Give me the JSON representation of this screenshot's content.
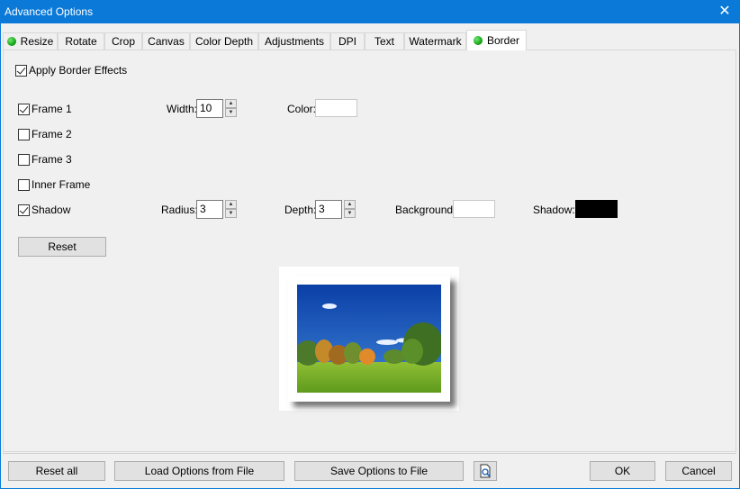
{
  "window": {
    "title": "Advanced Options",
    "close": "✕"
  },
  "tabs": [
    {
      "label": "Resize",
      "dot": true
    },
    {
      "label": "Rotate",
      "dot": false
    },
    {
      "label": "Crop",
      "dot": false
    },
    {
      "label": "Canvas",
      "dot": false
    },
    {
      "label": "Color Depth",
      "dot": false
    },
    {
      "label": "Adjustments",
      "dot": false
    },
    {
      "label": "DPI",
      "dot": false
    },
    {
      "label": "Text",
      "dot": false
    },
    {
      "label": "Watermark",
      "dot": false
    },
    {
      "label": "Border",
      "dot": true,
      "active": true
    }
  ],
  "border": {
    "apply": {
      "label": "Apply Border Effects",
      "checked": true
    },
    "frame1": {
      "label": "Frame 1",
      "checked": true
    },
    "frame2": {
      "label": "Frame 2",
      "checked": false
    },
    "frame3": {
      "label": "Frame 3",
      "checked": false
    },
    "inner": {
      "label": "Inner Frame",
      "checked": false
    },
    "shadow": {
      "label": "Shadow",
      "checked": true
    },
    "width_label": "Width:",
    "width_value": "10",
    "color_label": "Color:",
    "color_value": "#ffffff",
    "radius_label": "Radius:",
    "radius_value": "3",
    "depth_label": "Depth:",
    "depth_value": "3",
    "background_label": "Background:",
    "background_value": "#ffffff",
    "shadow_label": "Shadow:",
    "shadow_value": "#000000",
    "reset_label": "Reset"
  },
  "footer": {
    "reset_all": "Reset all",
    "load": "Load Options from File",
    "save": "Save Options to File",
    "preview_icon": "preview-document-icon",
    "ok": "OK",
    "cancel": "Cancel"
  }
}
